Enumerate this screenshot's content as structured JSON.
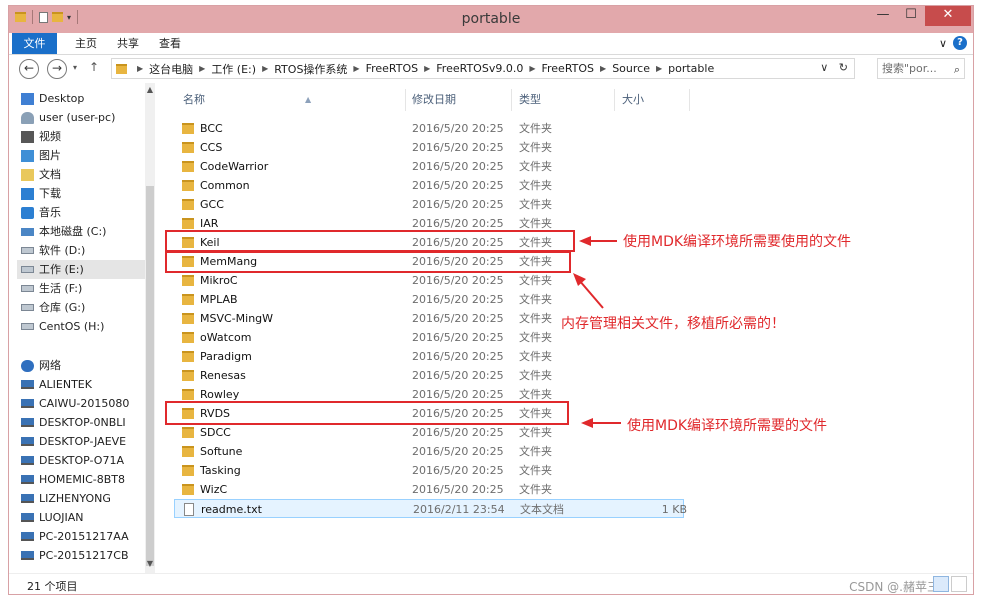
{
  "window": {
    "title": "portable",
    "controls": {
      "minimize": "—",
      "maximize": "☐",
      "close": "✕"
    }
  },
  "ribbon": {
    "file": "文件",
    "tabs": [
      "主页",
      "共享",
      "查看"
    ],
    "expand": "∨",
    "help": "?"
  },
  "address": {
    "segments": [
      "这台电脑",
      "工作 (E:)",
      "RTOS操作系统",
      "FreeRTOS",
      "FreeRTOSv9.0.0",
      "FreeRTOS",
      "Source",
      "portable"
    ],
    "dropdown": "∨",
    "refresh": "↻"
  },
  "search": {
    "placeholder": "搜索\"por..."
  },
  "sidebar": {
    "items": [
      {
        "label": "Desktop",
        "icon": "desktop-icon"
      },
      {
        "label": "user (user-pc)",
        "icon": "user-folder-icon"
      },
      {
        "label": "视频",
        "icon": "video-icon"
      },
      {
        "label": "图片",
        "icon": "pictures-icon"
      },
      {
        "label": "文档",
        "icon": "documents-icon"
      },
      {
        "label": "下载",
        "icon": "downloads-icon"
      },
      {
        "label": "音乐",
        "icon": "music-icon"
      },
      {
        "label": "本地磁盘 (C:)",
        "icon": "system-drive-icon"
      },
      {
        "label": "软件 (D:)",
        "icon": "drive-icon"
      },
      {
        "label": "工作 (E:)",
        "icon": "drive-icon",
        "selected": true
      },
      {
        "label": "生活 (F:)",
        "icon": "drive-icon"
      },
      {
        "label": "仓库 (G:)",
        "icon": "drive-icon"
      },
      {
        "label": "CentOS (H:)",
        "icon": "drive-icon"
      }
    ],
    "network": {
      "label": "网络",
      "icon": "network-icon",
      "items": [
        "ALIENTEK",
        "CAIWU-2015080",
        "DESKTOP-0NBLI",
        "DESKTOP-JAEVE",
        "DESKTOP-O71A",
        "HOMEMIC-8BT8",
        "LIZHENYONG",
        "LUOJIAN",
        "PC-20151217AA",
        "PC-20151217CB"
      ]
    }
  },
  "columns": {
    "name": "名称",
    "date": "修改日期",
    "type": "类型",
    "size": "大小"
  },
  "files": [
    {
      "name": "BCC",
      "date": "2016/5/20 20:25",
      "type": "文件夹",
      "size": "",
      "kind": "folder"
    },
    {
      "name": "CCS",
      "date": "2016/5/20 20:25",
      "type": "文件夹",
      "size": "",
      "kind": "folder"
    },
    {
      "name": "CodeWarrior",
      "date": "2016/5/20 20:25",
      "type": "文件夹",
      "size": "",
      "kind": "folder"
    },
    {
      "name": "Common",
      "date": "2016/5/20 20:25",
      "type": "文件夹",
      "size": "",
      "kind": "folder"
    },
    {
      "name": "GCC",
      "date": "2016/5/20 20:25",
      "type": "文件夹",
      "size": "",
      "kind": "folder"
    },
    {
      "name": "IAR",
      "date": "2016/5/20 20:25",
      "type": "文件夹",
      "size": "",
      "kind": "folder"
    },
    {
      "name": "Keil",
      "date": "2016/5/20 20:25",
      "type": "文件夹",
      "size": "",
      "kind": "folder"
    },
    {
      "name": "MemMang",
      "date": "2016/5/20 20:25",
      "type": "文件夹",
      "size": "",
      "kind": "folder"
    },
    {
      "name": "MikroC",
      "date": "2016/5/20 20:25",
      "type": "文件夹",
      "size": "",
      "kind": "folder"
    },
    {
      "name": "MPLAB",
      "date": "2016/5/20 20:25",
      "type": "文件夹",
      "size": "",
      "kind": "folder"
    },
    {
      "name": "MSVC-MingW",
      "date": "2016/5/20 20:25",
      "type": "文件夹",
      "size": "",
      "kind": "folder"
    },
    {
      "name": "oWatcom",
      "date": "2016/5/20 20:25",
      "type": "文件夹",
      "size": "",
      "kind": "folder"
    },
    {
      "name": "Paradigm",
      "date": "2016/5/20 20:25",
      "type": "文件夹",
      "size": "",
      "kind": "folder"
    },
    {
      "name": "Renesas",
      "date": "2016/5/20 20:25",
      "type": "文件夹",
      "size": "",
      "kind": "folder"
    },
    {
      "name": "Rowley",
      "date": "2016/5/20 20:25",
      "type": "文件夹",
      "size": "",
      "kind": "folder"
    },
    {
      "name": "RVDS",
      "date": "2016/5/20 20:25",
      "type": "文件夹",
      "size": "",
      "kind": "folder"
    },
    {
      "name": "SDCC",
      "date": "2016/5/20 20:25",
      "type": "文件夹",
      "size": "",
      "kind": "folder"
    },
    {
      "name": "Softune",
      "date": "2016/5/20 20:25",
      "type": "文件夹",
      "size": "",
      "kind": "folder"
    },
    {
      "name": "Tasking",
      "date": "2016/5/20 20:25",
      "type": "文件夹",
      "size": "",
      "kind": "folder"
    },
    {
      "name": "WizC",
      "date": "2016/5/20 20:25",
      "type": "文件夹",
      "size": "",
      "kind": "folder"
    },
    {
      "name": "readme.txt",
      "date": "2016/2/11 23:54",
      "type": "文本文档",
      "size": "1 KB",
      "kind": "text",
      "selected": true
    }
  ],
  "annotations": {
    "keil": "使用MDK编译环境所需要使用的文件",
    "memmang": "内存管理相关文件，移植所必需的！",
    "rvds": "使用MDK编译环境所需要的文件"
  },
  "status": {
    "count": "21 个项目"
  },
  "watermark": "CSDN @.赭苹三",
  "colors": {
    "title_bar": "#e2a8ab",
    "accent": "#1a6fc9",
    "annotation": "#e0292c"
  }
}
